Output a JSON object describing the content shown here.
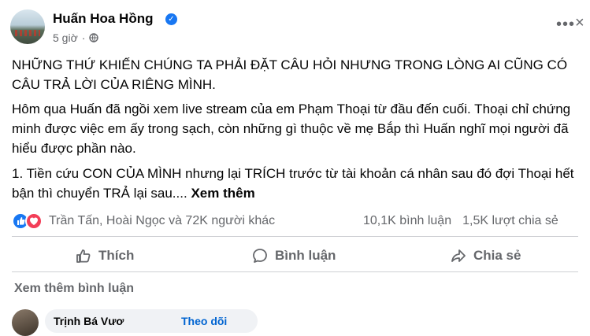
{
  "post": {
    "author": "Huấn Hoa Hồng",
    "time": "5 giờ",
    "separator": "·",
    "paragraph1": "NHỮNG THỨ KHIẾN CHÚNG TA PHẢI ĐẶT CÂU HỎI NHƯNG TRONG LÒNG AI CŨNG CÓ CÂU TRẢ LỜI CỦA RIÊNG MÌNH.",
    "paragraph2": "Hôm qua Huấn đã ngồi xem live stream của em Phạm Thoại từ đầu đến cuối. Thoại chỉ chứng minh được việc em ấy trong sạch, còn những gì thuộc về mẹ Bắp thì Huấn nghĩ mọi người đã hiểu được phần nào.",
    "paragraph3": "1. Tiền cứu CON CỦA MÌNH nhưng lại TRÍCH trước từ tài khoản cá nhân sau đó đợi Thoại hết bận thì chuyển TRẢ lại sau....",
    "see_more": "Xem thêm"
  },
  "stats": {
    "reactors": "Trần Tấn, Hoài Ngọc và 72K người khác",
    "comments": "10,1K bình luận",
    "shares": "1,5K lượt chia sẻ"
  },
  "actions": {
    "like": "Thích",
    "comment": "Bình luận",
    "share": "Chia sẻ"
  },
  "comments": {
    "view_more": "Xem thêm bình luận",
    "first_name": "Trịnh Bá Vươ",
    "follow": "Theo dõi"
  }
}
